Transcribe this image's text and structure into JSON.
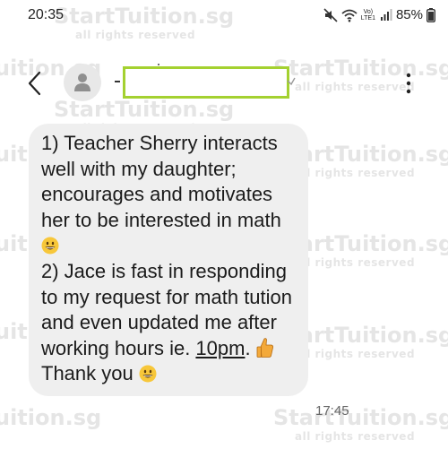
{
  "status_bar": {
    "time": "20:35",
    "lte_top": "Vo)",
    "lte_bottom": "LTE1",
    "battery": "85%"
  },
  "header": {
    "contact_name": ""
  },
  "message": {
    "line_1": "1) Teacher Sherry interacts well with my daughter; encourages and motivates her to be interested in math ",
    "line_2": "2) Jace is fast in responding to my request for math tution and even updated me after working hours ie. ",
    "time_underlined": "10pm",
    "after_time": ". ",
    "thank_you": " Thank you ",
    "timestamp": "17:45"
  },
  "watermark": {
    "brand": "StartTuition.sg",
    "notice": "all rights reserved"
  },
  "icons": {
    "back": "chevron-left-icon",
    "avatar": "person-icon",
    "more": "more-vertical-icon",
    "mute": "mute-icon",
    "wifi": "wifi-icon",
    "signal": "signal-icon",
    "battery": "battery-icon",
    "smiley": "grinning-face-emoji",
    "thumbs_up": "thumbs-up-emoji"
  }
}
